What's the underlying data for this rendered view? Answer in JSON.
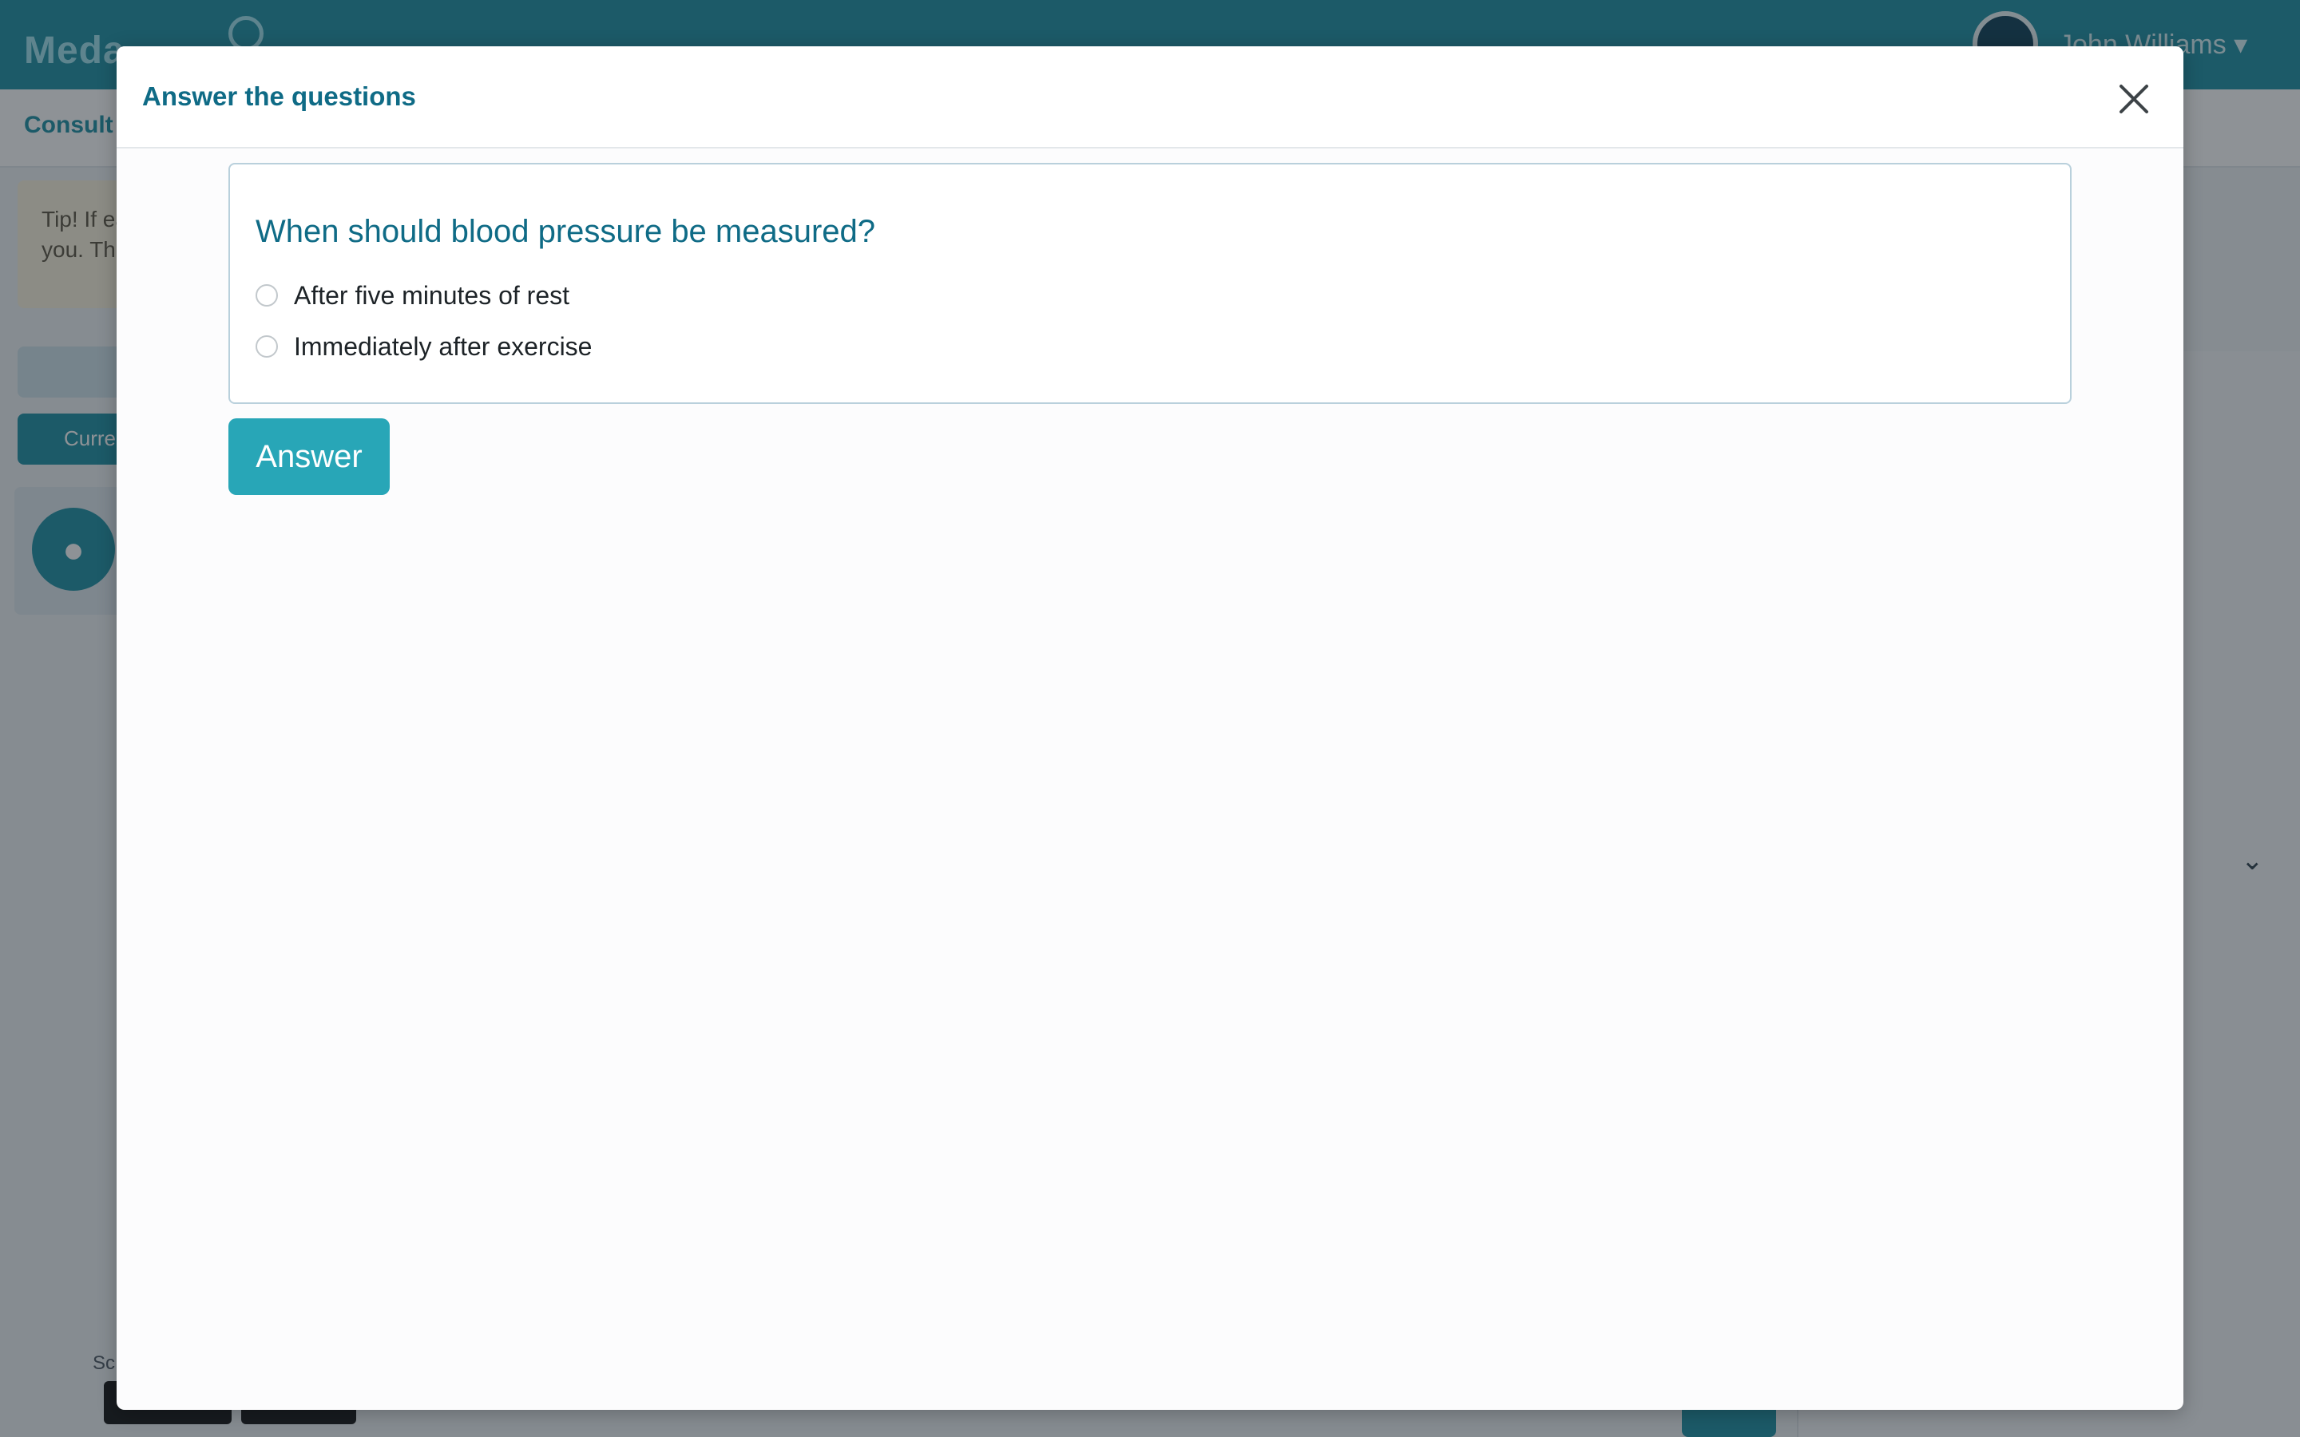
{
  "background": {
    "logo_text": "Meda",
    "user_name": "John Williams ▾",
    "subtitle": "Consult",
    "tip_text": "Tip! If easier you. Th",
    "dark_button_label": "Curre",
    "avatar_icon": "user-icon",
    "chevron_icon": "chevron-down-icon",
    "footer_text": "Sc"
  },
  "modal": {
    "title": "Answer the questions",
    "close_icon": "close-icon",
    "question": {
      "text": "When should blood pressure be measured?",
      "options": [
        {
          "label": "After five minutes of rest",
          "selected": false
        },
        {
          "label": "Immediately after exercise",
          "selected": false
        }
      ]
    },
    "answer_button_label": "Answer"
  },
  "colors": {
    "brand": "#1b8fa3",
    "title_teal": "#0f6b86",
    "button_teal": "#28a6b7"
  }
}
